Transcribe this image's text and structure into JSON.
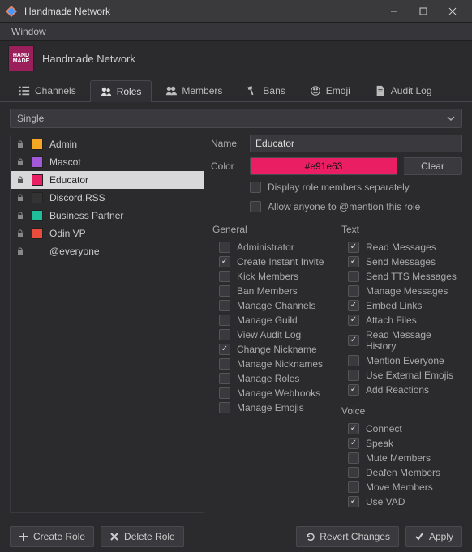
{
  "window": {
    "title": "Handmade Network"
  },
  "menu": {
    "window": "Window"
  },
  "server": {
    "name": "Handmade Network",
    "logo_text": "HAND\nMADE"
  },
  "tabs": {
    "channels": "Channels",
    "roles": "Roles",
    "members": "Members",
    "bans": "Bans",
    "emoji": "Emoji",
    "auditlog": "Audit Log"
  },
  "selector": {
    "value": "Single"
  },
  "roles": [
    {
      "name": "Admin",
      "color": "#f5a623",
      "locked": true,
      "selected": false
    },
    {
      "name": "Mascot",
      "color": "#a259d9",
      "locked": true,
      "selected": false
    },
    {
      "name": "Educator",
      "color": "#e91e63",
      "locked": true,
      "selected": true
    },
    {
      "name": "Discord.RSS",
      "color": "#333333",
      "locked": true,
      "selected": false
    },
    {
      "name": "Business Partner",
      "color": "#1fbf9c",
      "locked": true,
      "selected": false
    },
    {
      "name": "Odin VP",
      "color": "#e74c3c",
      "locked": true,
      "selected": false
    },
    {
      "name": "@everyone",
      "color": null,
      "locked": true,
      "selected": false
    }
  ],
  "detail": {
    "name_label": "Name",
    "name_value": "Educator",
    "color_label": "Color",
    "color_value": "#e91e63",
    "clear_label": "Clear",
    "display_separately": {
      "label": "Display role members separately",
      "checked": false
    },
    "allow_mention": {
      "label": "Allow anyone to @mention this role",
      "checked": false
    }
  },
  "perms": {
    "general": {
      "title": "General",
      "items": [
        {
          "label": "Administrator",
          "checked": false
        },
        {
          "label": "Create Instant Invite",
          "checked": true
        },
        {
          "label": "Kick Members",
          "checked": false
        },
        {
          "label": "Ban Members",
          "checked": false
        },
        {
          "label": "Manage Channels",
          "checked": false
        },
        {
          "label": "Manage Guild",
          "checked": false
        },
        {
          "label": "View Audit Log",
          "checked": false
        },
        {
          "label": "Change Nickname",
          "checked": true
        },
        {
          "label": "Manage Nicknames",
          "checked": false
        },
        {
          "label": "Manage Roles",
          "checked": false
        },
        {
          "label": "Manage Webhooks",
          "checked": false
        },
        {
          "label": "Manage Emojis",
          "checked": false
        }
      ]
    },
    "text": {
      "title": "Text",
      "items": [
        {
          "label": "Read Messages",
          "checked": true
        },
        {
          "label": "Send Messages",
          "checked": true
        },
        {
          "label": "Send TTS Messages",
          "checked": false
        },
        {
          "label": "Manage Messages",
          "checked": false
        },
        {
          "label": "Embed Links",
          "checked": true
        },
        {
          "label": "Attach Files",
          "checked": true
        },
        {
          "label": "Read Message History",
          "checked": true
        },
        {
          "label": "Mention Everyone",
          "checked": false
        },
        {
          "label": "Use External Emojis",
          "checked": false
        },
        {
          "label": "Add Reactions",
          "checked": true
        }
      ]
    },
    "voice": {
      "title": "Voice",
      "items": [
        {
          "label": "Connect",
          "checked": true
        },
        {
          "label": "Speak",
          "checked": true
        },
        {
          "label": "Mute Members",
          "checked": false
        },
        {
          "label": "Deafen Members",
          "checked": false
        },
        {
          "label": "Move Members",
          "checked": false
        },
        {
          "label": "Use VAD",
          "checked": true
        }
      ]
    }
  },
  "buttons": {
    "create_role": "Create Role",
    "delete_role": "Delete Role",
    "revert": "Revert Changes",
    "apply": "Apply"
  }
}
